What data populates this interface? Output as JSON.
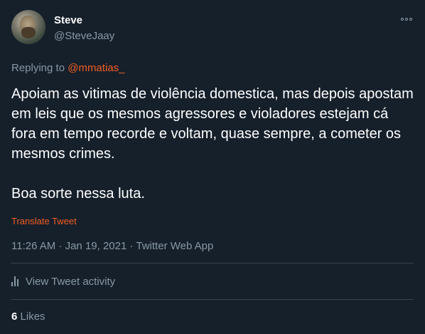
{
  "user": {
    "name": "Steve",
    "handle": "@SteveJaay"
  },
  "icons": {
    "avatar": "avatar-photo",
    "more": "more-options-icon",
    "activity": "bar-chart-icon"
  },
  "reply": {
    "prefix": "Replying to ",
    "mention": "@mmatias_"
  },
  "tweet": {
    "text": "Apoiam as vitimas de violência domestica, mas depois apostam em leis que os mesmos agressores e violadores estejam cá fora em tempo recorde e voltam, quase sempre, a cometer os mesmos crimes.\n\nBoa sorte nessa luta.",
    "translate_label": "Translate Tweet",
    "meta": "11:26 AM · Jan 19, 2021 · Twitter Web App"
  },
  "activity": {
    "label": "View Tweet activity"
  },
  "stats": {
    "likes_count": "6",
    "likes_label": "Likes"
  },
  "colors": {
    "background": "#15202b",
    "accent": "#f45d22",
    "muted": "#8899a6",
    "divider": "#38444d"
  }
}
